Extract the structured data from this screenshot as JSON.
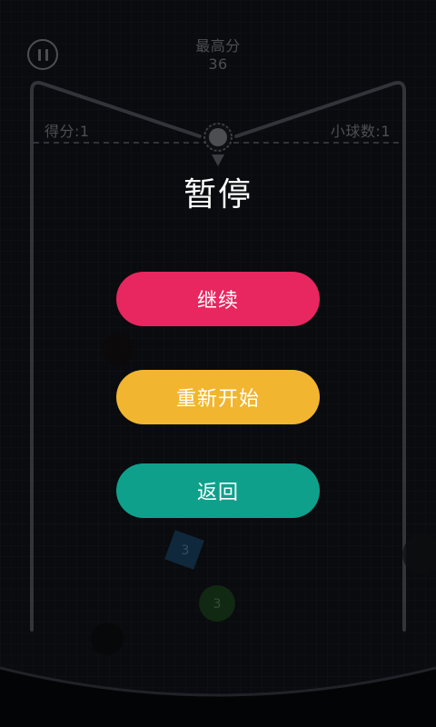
{
  "hud": {
    "best_label": "最高分",
    "best_value": "36",
    "score_label": "得分:1",
    "balls_label": "小球数:1"
  },
  "pause_menu": {
    "title": "暂停",
    "resume_label": "继续",
    "restart_label": "重新开始",
    "back_label": "返回"
  },
  "blocks": [
    {
      "shape": "diamond",
      "number": "3"
    },
    {
      "shape": "circle",
      "number": "3"
    }
  ],
  "colors": {
    "resume": "#e8265f",
    "restart": "#f2b530",
    "back": "#0fa08c",
    "hud_text": "#8b8f94",
    "title": "#ffffff"
  },
  "icons": {
    "pause": "pause-icon",
    "launcher": "ball-launcher-icon"
  }
}
